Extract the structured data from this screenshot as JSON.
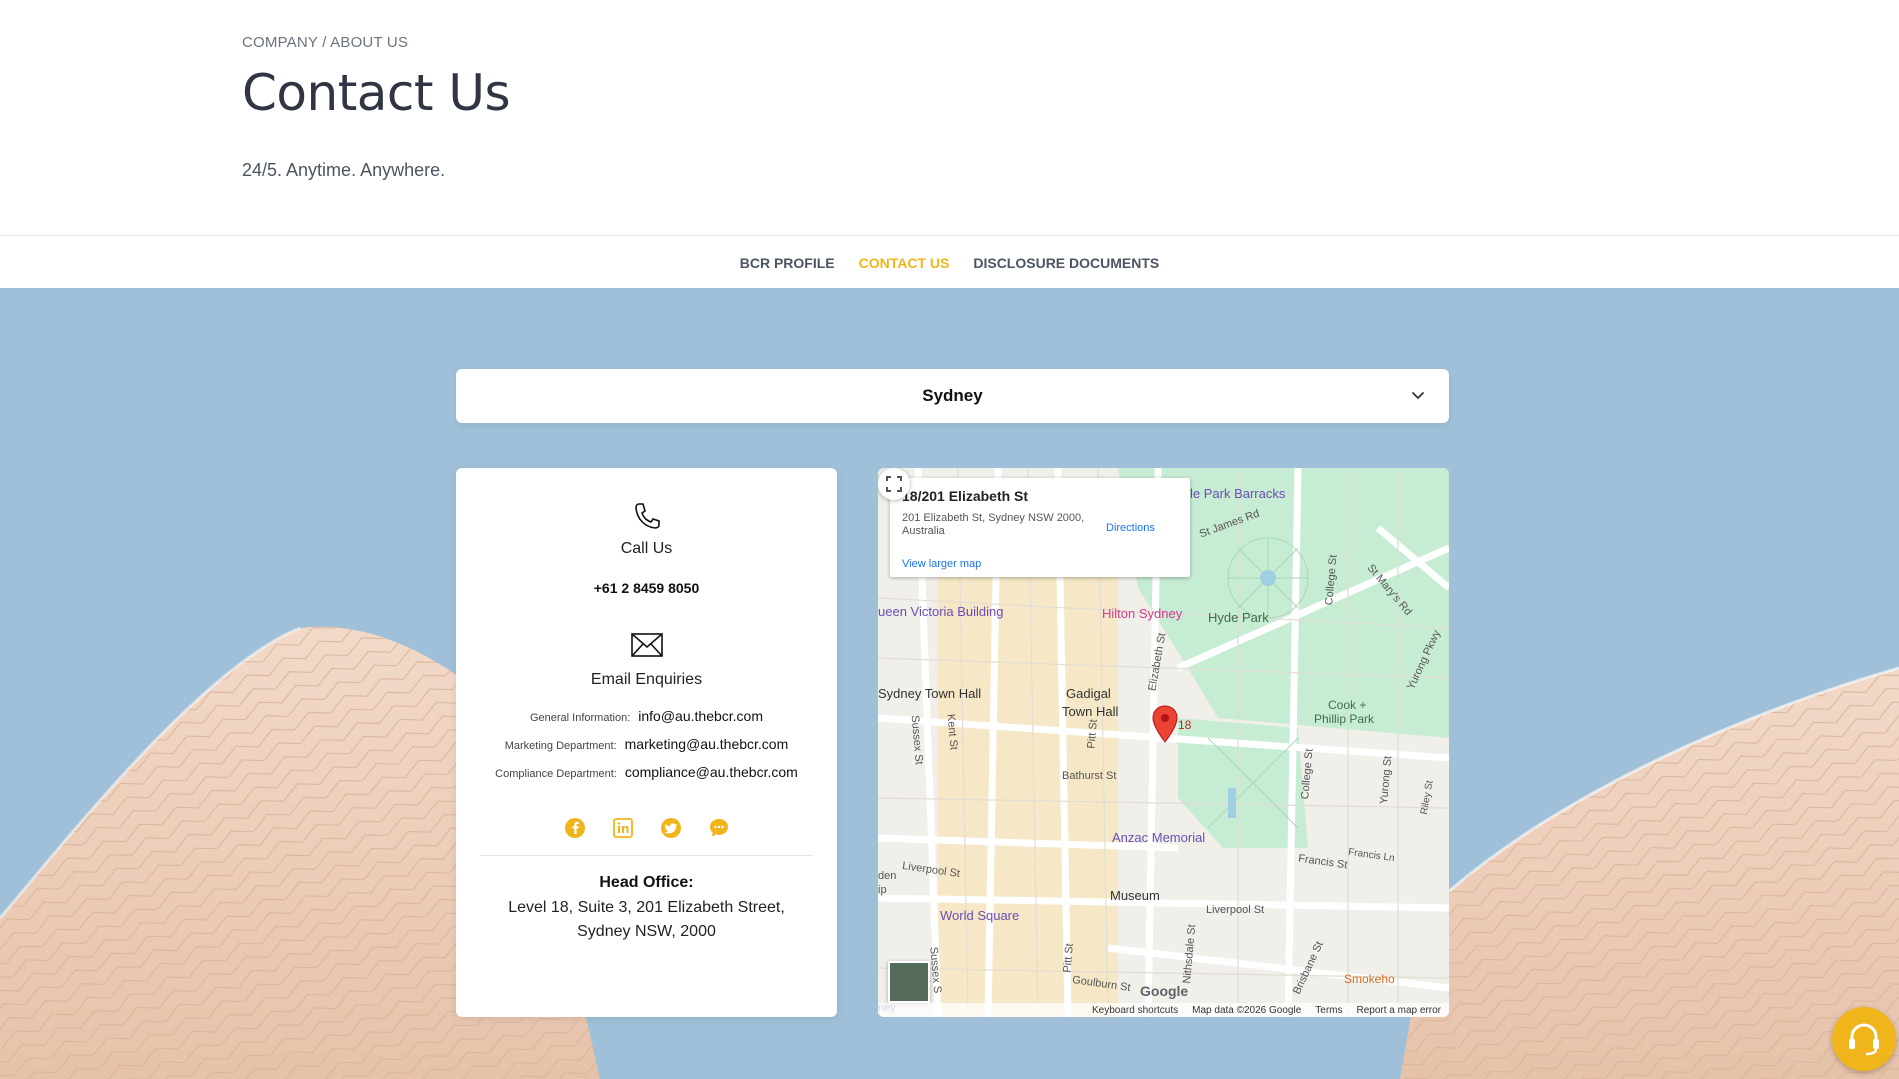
{
  "breadcrumb": {
    "company": "COMPANY",
    "sep": "/",
    "about": "ABOUT US"
  },
  "page": {
    "title": "Contact Us",
    "subtitle": "24/5. Anytime. Anywhere."
  },
  "nav": {
    "items": [
      {
        "label": "BCR PROFILE",
        "active": false
      },
      {
        "label": "CONTACT US",
        "active": true
      },
      {
        "label": "DISCLOSURE DOCUMENTS",
        "active": false
      }
    ]
  },
  "location_select": {
    "value": "Sydney",
    "icon": "chevron-down-icon"
  },
  "contact": {
    "call_heading": "Call Us",
    "phone": "+61 2 8459 8050",
    "email_heading": "Email Enquiries",
    "emails": [
      {
        "label": "General Information:",
        "value": "info@au.thebcr.com"
      },
      {
        "label": "Marketing Department:",
        "value": "marketing@au.thebcr.com"
      },
      {
        "label": "Compliance Department:",
        "value": "compliance@au.thebcr.com"
      }
    ],
    "social_icons": [
      "facebook-icon",
      "linkedin-icon",
      "twitter-icon",
      "chat-icon"
    ],
    "office_heading": "Head Office:",
    "office_line1": "Level 18, Suite 3, 201 Elizabeth Street,",
    "office_line2": "Sydney NSW, 2000"
  },
  "map": {
    "place_title": "18/201 Elizabeth St",
    "place_address": "201 Elizabeth St, Sydney NSW 2000, Australia",
    "view_larger": "View larger map",
    "directions": "Directions",
    "marker_label": "18",
    "labels": {
      "queen_victoria": "ueen Victoria Building",
      "hilton": "Hilton Sydney",
      "hyde_park": "Hyde Park",
      "st_james": "St James Rd",
      "barracks": "le Park Barracks",
      "town_hall_place": "Sydney Town Hall",
      "gadigal": "Gadigal",
      "town_hall": "Town Hall",
      "cook_phillip": "Cook +",
      "cook_phillip2": "Phillip Park",
      "bathurst": "Bathurst St",
      "anzac": "Anzac Memorial",
      "museum": "Museum",
      "world_square": "World Square",
      "liverpool1": "Liverpool St",
      "liverpool2": "Liverpool St",
      "francis": "Francis St",
      "francis_ln": "Francis Ln",
      "goulburn": "Goulburn St",
      "smokehouse": "Smokeho",
      "elizabeth": "Elizabeth St",
      "college": "College St",
      "college2": "College St",
      "stmarys": "St Mary's Rd",
      "yurong_pkwy": "Yurong Pkwy",
      "yurong": "Yurong St",
      "riley": "Riley St",
      "kent": "Kent St",
      "sussex": "Sussex St",
      "sussex2": "Sussex S",
      "pitt": "Pitt St",
      "pitt2": "Pitt St",
      "nithsdale": "Nithsdale St",
      "brisbane": "Brisbane St",
      "den": "den",
      "ip": "ip",
      "ney": "ney"
    },
    "footer": {
      "shortcuts": "Keyboard shortcuts",
      "data": "Map data ©2026 Google",
      "terms": "Terms",
      "report": "Report a map error"
    },
    "google": "Google"
  }
}
